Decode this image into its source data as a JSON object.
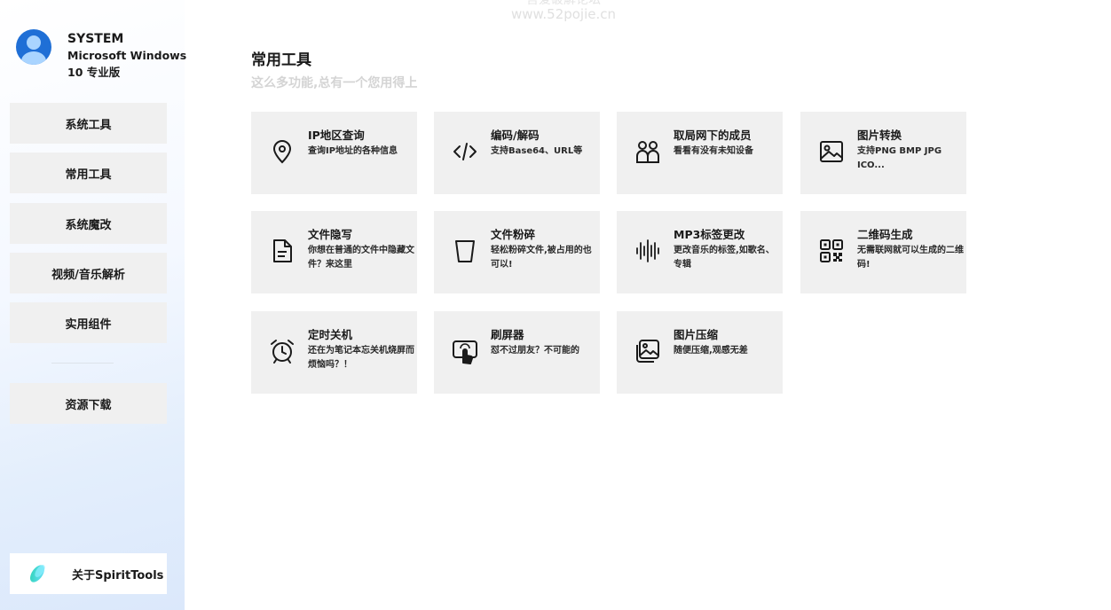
{
  "watermark": {
    "line1": "吾爱破解论坛",
    "line2": "www.52pojie.cn"
  },
  "user": {
    "name": "SYSTEM",
    "os_line1": "Microsoft Windows",
    "os_line2": "10 专业版"
  },
  "sidebar": {
    "items": [
      {
        "label": "系统工具"
      },
      {
        "label": "常用工具"
      },
      {
        "label": "系统魔改"
      },
      {
        "label": "视频/音乐解析"
      },
      {
        "label": "实用组件"
      },
      {
        "label": "资源下载"
      }
    ],
    "about_label": "关于SpiritTools"
  },
  "main": {
    "title": "常用工具",
    "subtitle": "这么多功能,总有一个您用得上",
    "cards": [
      {
        "title": "IP地区查询",
        "desc": "查询IP地址的各种信息",
        "icon": "location-pin-icon"
      },
      {
        "title": "编码/解码",
        "desc": "支持Base64、URL等",
        "icon": "code-icon"
      },
      {
        "title": "取局网下的成员",
        "desc": "看看有没有未知设备",
        "icon": "people-icon"
      },
      {
        "title": "图片转换",
        "desc": "支持PNG BMP JPG ICO...",
        "icon": "image-icon"
      },
      {
        "title": "文件隐写",
        "desc": "你想在普通的文件中隐藏文件？来这里",
        "icon": "document-icon"
      },
      {
        "title": "文件粉碎",
        "desc": "轻松粉碎文件,被占用的也可以!",
        "icon": "trash-icon"
      },
      {
        "title": "MP3标签更改",
        "desc": "更改音乐的标签,如歌名、专辑",
        "icon": "soundwave-icon"
      },
      {
        "title": "二维码生成",
        "desc": "无需联网就可以生成的二维码!",
        "icon": "qr-code-icon"
      },
      {
        "title": "定时关机",
        "desc": "还在为笔记本忘关机烧屏而烦恼吗？！",
        "icon": "alarm-clock-icon"
      },
      {
        "title": "刷屏器",
        "desc": "怼不过朋友？不可能的",
        "icon": "touch-screen-icon"
      },
      {
        "title": "图片压缩",
        "desc": "随便压缩,观感无差",
        "icon": "image-stack-icon"
      }
    ]
  }
}
